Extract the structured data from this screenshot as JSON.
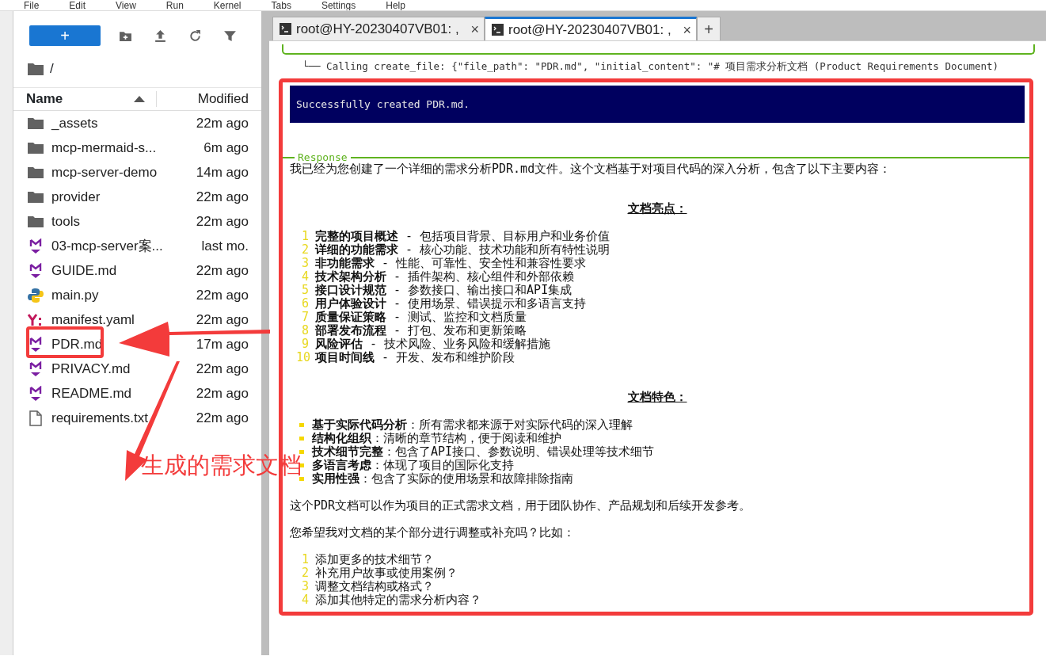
{
  "menu": [
    "File",
    "Edit",
    "View",
    "Run",
    "Kernel",
    "Tabs",
    "Settings",
    "Help"
  ],
  "file_browser": {
    "new_button": "+",
    "path": "/",
    "columns": [
      {
        "label": "Name",
        "sorted": true
      },
      {
        "label": "Modified",
        "sorted": false
      }
    ],
    "rows": [
      {
        "name": "_assets",
        "modified": "22m ago",
        "kind": "folder",
        "annotated": false
      },
      {
        "name": "mcp-mermaid-s...",
        "modified": "6m ago",
        "kind": "folder",
        "annotated": false
      },
      {
        "name": "mcp-server-demo",
        "modified": "14m ago",
        "kind": "folder",
        "annotated": false
      },
      {
        "name": "provider",
        "modified": "22m ago",
        "kind": "folder",
        "annotated": false
      },
      {
        "name": "tools",
        "modified": "22m ago",
        "kind": "folder",
        "annotated": false
      },
      {
        "name": "03-mcp-server案...",
        "modified": "last mo.",
        "kind": "markdown",
        "annotated": false
      },
      {
        "name": "GUIDE.md",
        "modified": "22m ago",
        "kind": "markdown",
        "annotated": false
      },
      {
        "name": "main.py",
        "modified": "22m ago",
        "kind": "python",
        "annotated": false
      },
      {
        "name": "manifest.yaml",
        "modified": "22m ago",
        "kind": "yaml",
        "annotated": false
      },
      {
        "name": "PDR.md",
        "modified": "17m ago",
        "kind": "markdown",
        "annotated": true
      },
      {
        "name": "PRIVACY.md",
        "modified": "22m ago",
        "kind": "markdown",
        "annotated": false
      },
      {
        "name": "README.md",
        "modified": "22m ago",
        "kind": "markdown",
        "annotated": false
      },
      {
        "name": "requirements.txt",
        "modified": "22m ago",
        "kind": "text",
        "annotated": false
      }
    ]
  },
  "tabs": [
    {
      "label": "root@HY-20230407VB01: ,",
      "selected": false,
      "close": "×"
    },
    {
      "label": "root@HY-20230407VB01: ,",
      "selected": true,
      "close": "×"
    }
  ],
  "new_tab": "+",
  "terminal": {
    "calling_line": "└── Calling create_file: {\"file_path\": \"PDR.md\", \"initial_content\": \"# 项目需求分析文档 (Product Requirements Document)",
    "result": "Successfully created PDR.md.",
    "response_label": "Response",
    "blocks": [
      {
        "kind": "paragraph",
        "text": "我已经为您创建了一个详细的需求分析PDR.md文件。这个文档基于对项目代码的深入分析，包含了以下主要内容："
      },
      {
        "kind": "heading",
        "text": "文档亮点："
      },
      {
        "kind": "numbered",
        "items": [
          {
            "number": "1",
            "text": "**完整的项目概述** - 包括项目背景、目标用户和业务价值"
          },
          {
            "number": "2",
            "text": "**详细的功能需求** - 核心功能、技术功能和所有特性说明"
          },
          {
            "number": "3",
            "text": "**非功能需求** - 性能、可靠性、安全性和兼容性要求"
          },
          {
            "number": "4",
            "text": "**技术架构分析** - 插件架构、核心组件和外部依赖"
          },
          {
            "number": "5",
            "text": "**接口设计规范** - 参数接口、输出接口和API集成"
          },
          {
            "number": "6",
            "text": "**用户体验设计** - 使用场景、错误提示和多语言支持"
          },
          {
            "number": "7",
            "text": "**质量保证策略** - 测试、监控和文档质量"
          },
          {
            "number": "8",
            "text": "**部署发布流程** - 打包、发布和更新策略"
          },
          {
            "number": "9",
            "text": "**风险评估** - 技术风险、业务风险和缓解措施"
          },
          {
            "number": "10",
            "text": "**项目时间线** - 开发、发布和维护阶段"
          }
        ]
      },
      {
        "kind": "heading",
        "text": "文档特色："
      },
      {
        "kind": "bullets",
        "items": [
          {
            "text": "**基于实际代码分析**：所有需求都来源于对实际代码的深入理解"
          },
          {
            "text": "**结构化组织**：清晰的章节结构，便于阅读和维护"
          },
          {
            "text": "**技术细节完整**：包含了API接口、参数说明、错误处理等技术细节"
          },
          {
            "text": "**多语言考虑**：体现了项目的国际化支持"
          },
          {
            "text": "**实用性强**：包含了实际的使用场景和故障排除指南"
          }
        ]
      },
      {
        "kind": "paragraph",
        "text": "这个PDR文档可以作为项目的正式需求文档，用于团队协作、产品规划和后续开发参考。"
      },
      {
        "kind": "paragraph",
        "text": "您希望我对文档的某个部分进行调整或补充吗？比如："
      },
      {
        "kind": "numbered",
        "items": [
          {
            "number": "1",
            "text": "添加更多的技术细节？"
          },
          {
            "number": "2",
            "text": "补充用户故事或使用案例？"
          },
          {
            "number": "3",
            "text": "调整文档结构或格式？"
          },
          {
            "number": "4",
            "text": "添加其他特定的需求分析内容？"
          }
        ]
      }
    ]
  },
  "annotation": {
    "label": "生成的需求文档"
  }
}
